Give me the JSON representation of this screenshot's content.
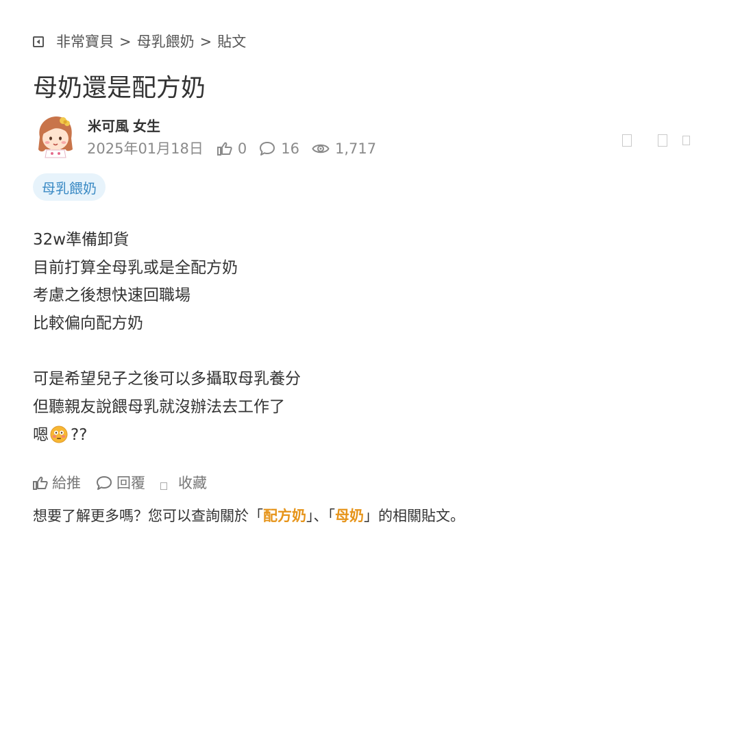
{
  "breadcrumb": {
    "items": [
      "非常寶貝",
      "母乳餵奶",
      "貼文"
    ],
    "separator": ">"
  },
  "post": {
    "title": "母奶還是配方奶",
    "author": {
      "name": "米可風",
      "gender": "女生"
    },
    "date": "2025年01月18日",
    "stats": {
      "likes": "0",
      "replies": "16",
      "views": "1,717"
    },
    "tag": "母乳餵奶",
    "content": {
      "lines": [
        "32w準備卸貨",
        "目前打算全母乳或是全配方奶",
        "考慮之後想快速回職場",
        "比較偏向配方奶",
        "",
        "可是希望兒子之後可以多攝取母乳養分",
        "但聽親友說餵母乳就沒辦法去工作了"
      ],
      "last_line_prefix": "嗯",
      "last_line_suffix": "??"
    }
  },
  "actions": {
    "like_label": "給推",
    "reply_label": "回覆",
    "save_label": "收藏"
  },
  "related": {
    "prefix": "想要了解更多嗎？您可以查詢關於「",
    "keyword1": "配方奶",
    "middle": "」、「",
    "keyword2": "母奶",
    "suffix": "」的相關貼文。"
  },
  "colors": {
    "tag_bg": "#e7f3fb",
    "tag_text": "#3a8ac4",
    "keyword": "#e6941a"
  },
  "icons": {
    "back": "back-arrow-box-icon",
    "like": "thumbs-up-icon",
    "reply": "speech-bubble-icon",
    "views": "eye-icon",
    "emoji": "flushed-face-emoji-icon"
  }
}
